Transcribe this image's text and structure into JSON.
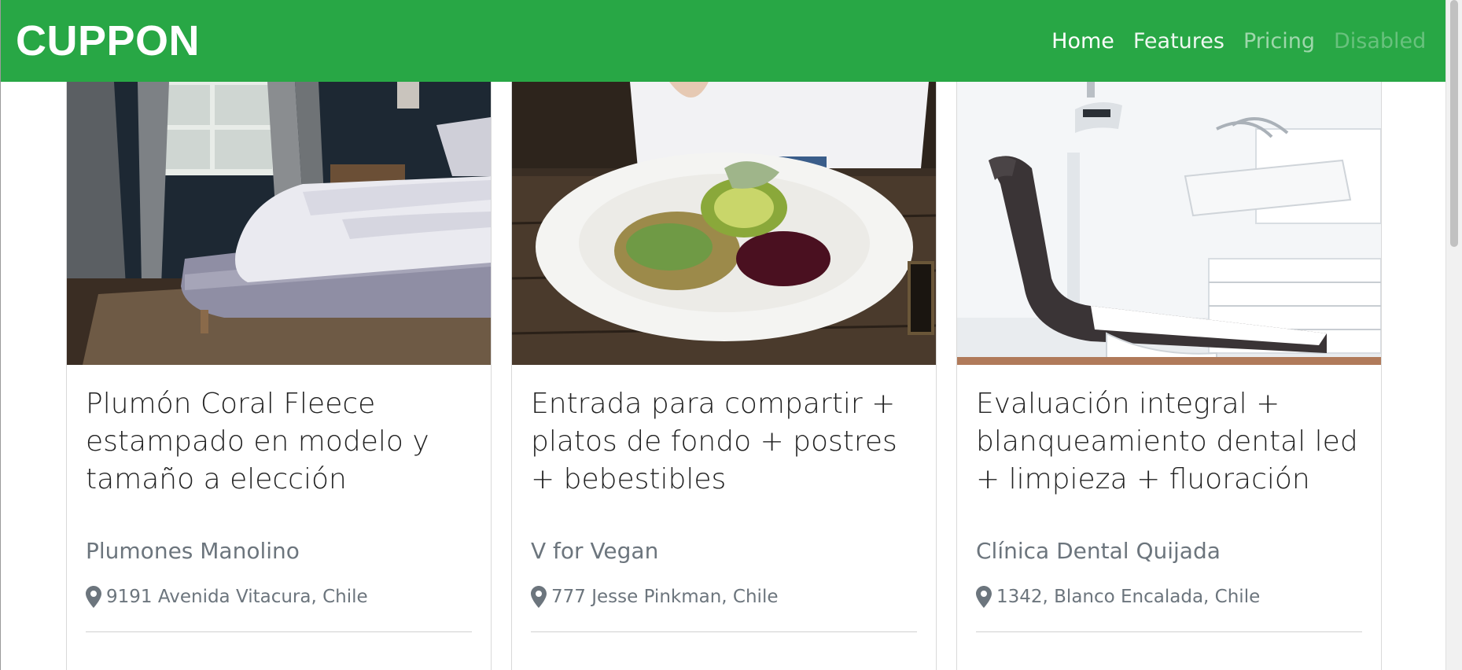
{
  "navbar": {
    "brand": "CUPPON",
    "links": [
      {
        "label": "Home"
      },
      {
        "label": "Features"
      },
      {
        "label": "Pricing"
      },
      {
        "label": "Disabled"
      }
    ],
    "color": "#28a745"
  },
  "cards": [
    {
      "image": "bedroom-photo",
      "title": "Plumón Coral Fleece estampado en modelo y tamaño a elección",
      "merchant": "Plumones Manolino",
      "location": "9191 Avenida Vitacura, Chile"
    },
    {
      "image": "food-plate-photo",
      "title": "Entrada para compartir + platos de fondo + postres + bebestibles",
      "merchant": "V for Vegan",
      "location": "777 Jesse Pinkman, Chile"
    },
    {
      "image": "dental-chair-photo",
      "title": "Evaluación integral + blanqueamiento dental led + limpieza + fluoración",
      "merchant": "Clínica Dental Quijada",
      "location": "1342, Blanco Encalada, Chile"
    }
  ]
}
